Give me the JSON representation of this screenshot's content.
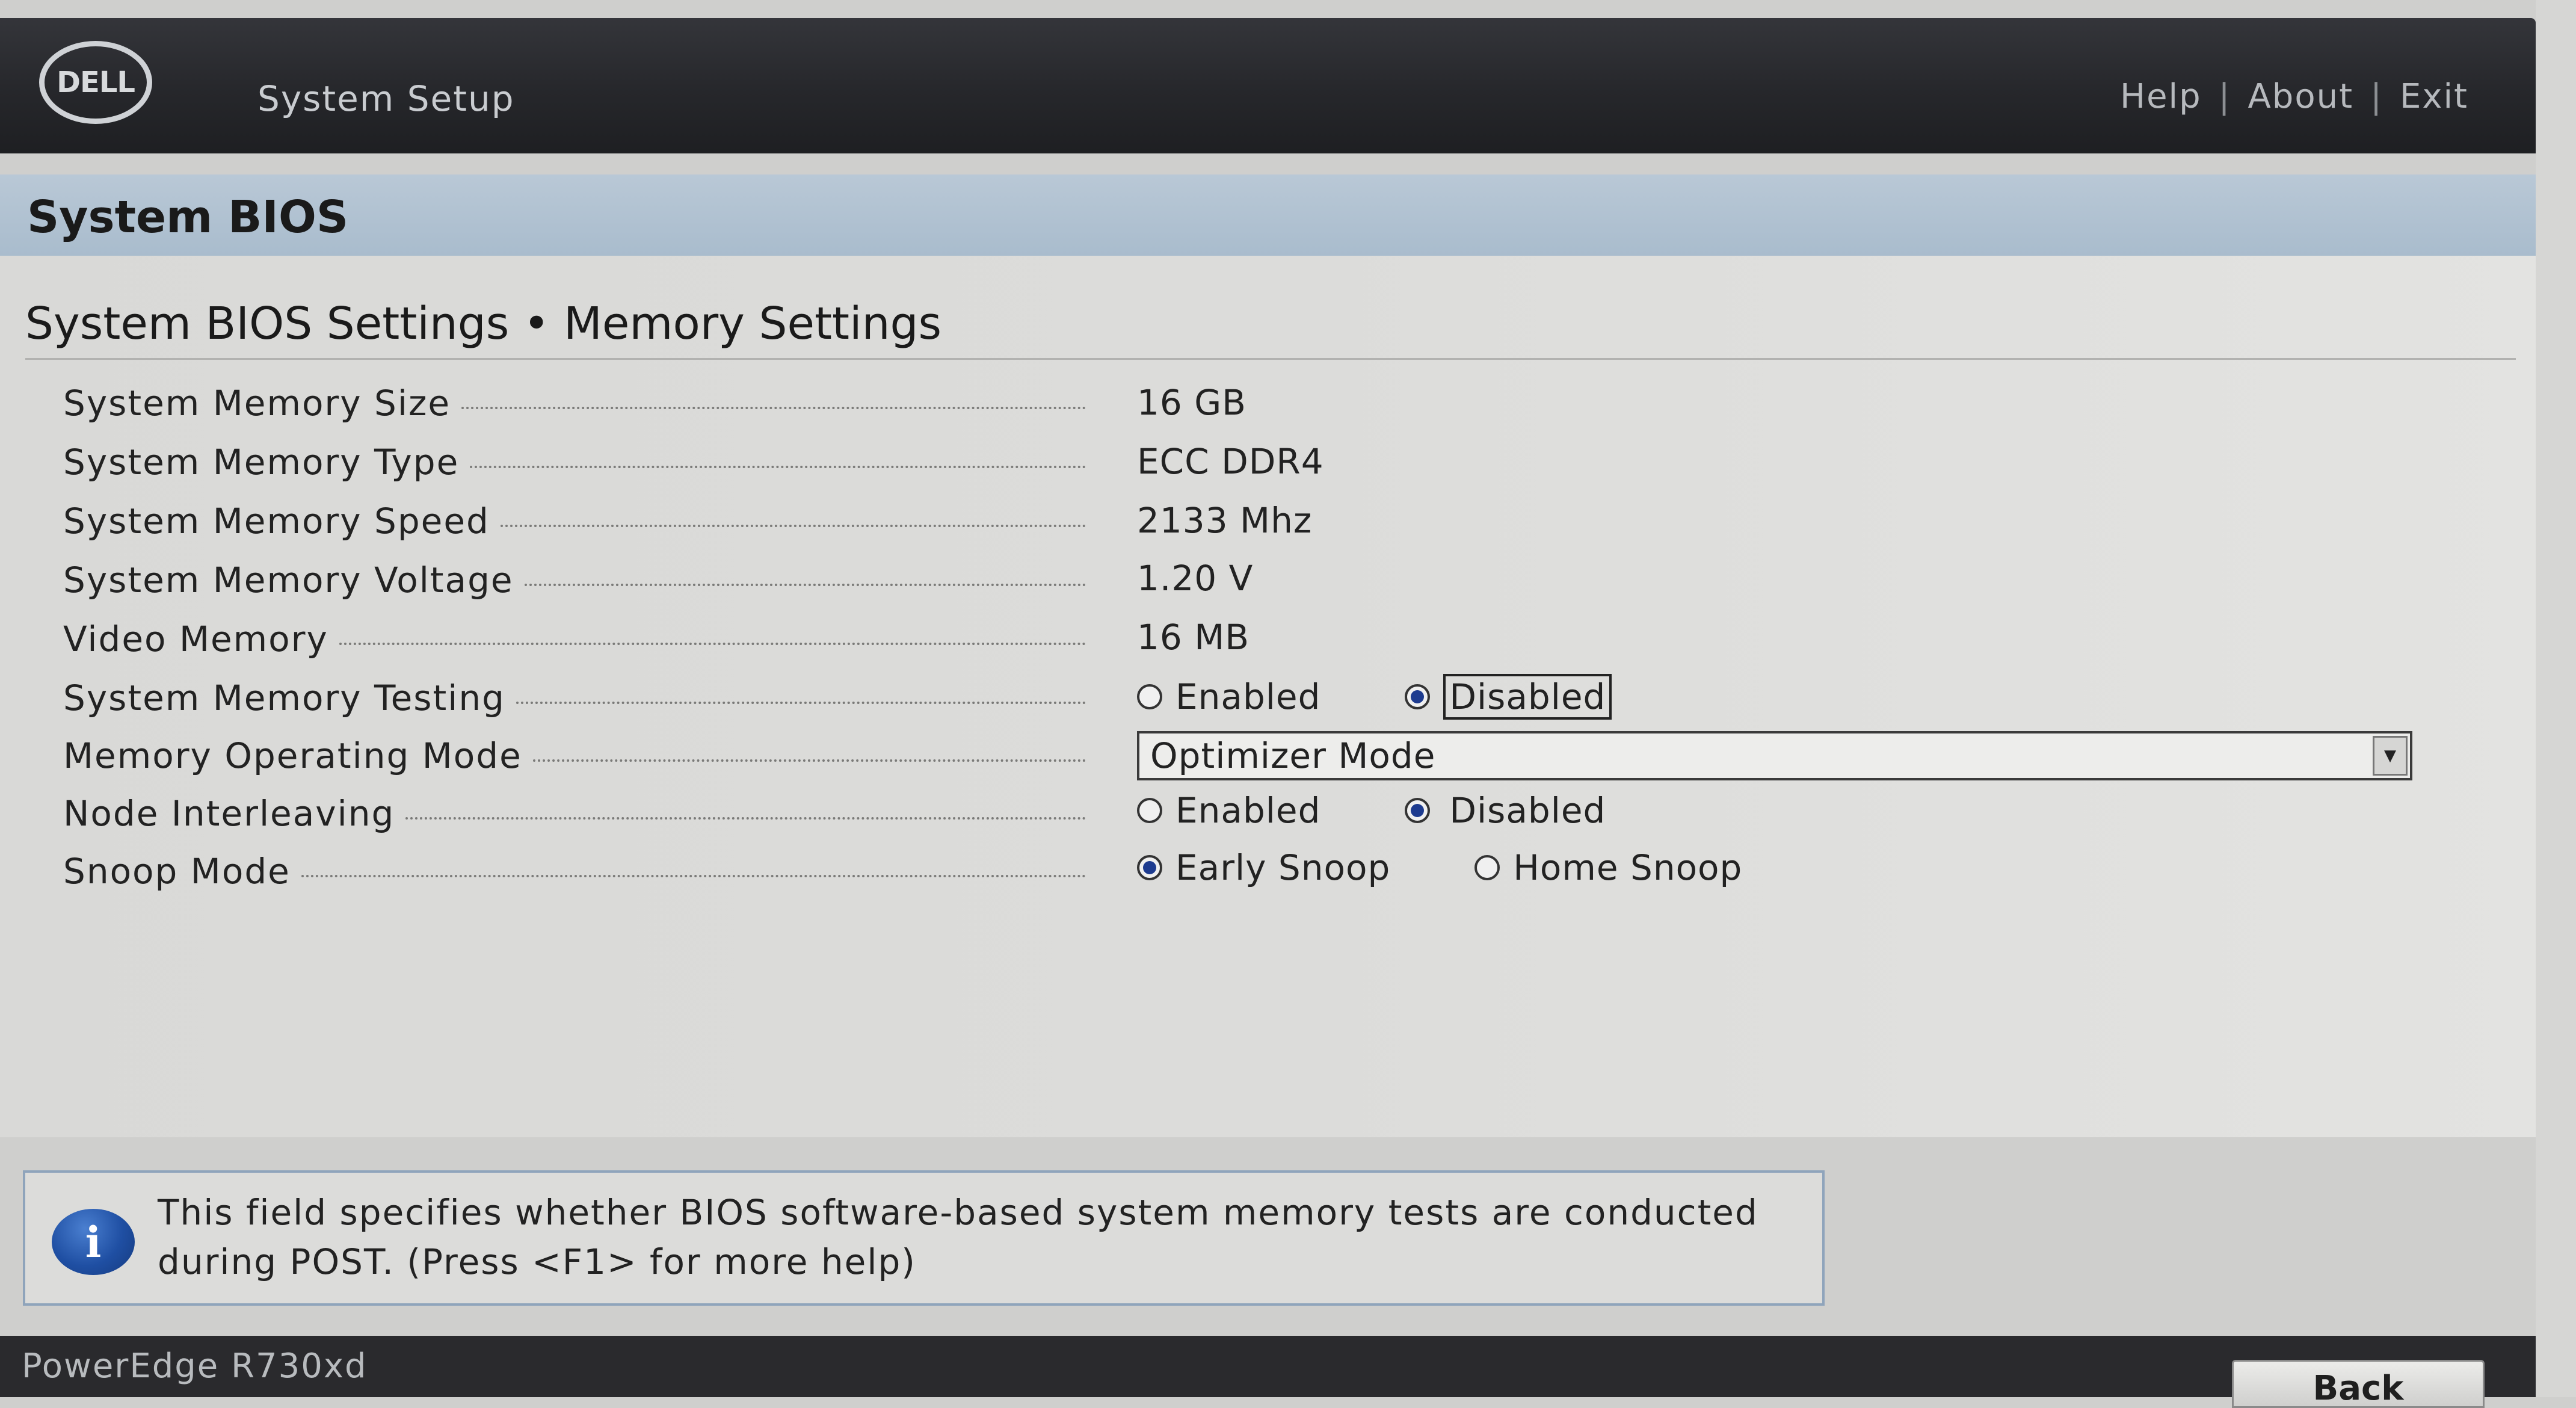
{
  "header": {
    "logo_text": "DELL",
    "app_title": "System Setup",
    "links": [
      "Help",
      "About",
      "Exit"
    ]
  },
  "section": {
    "title": "System BIOS"
  },
  "page": {
    "heading": "System BIOS Settings • Memory Settings",
    "rows": [
      {
        "label": "System Memory Size",
        "value": "16 GB"
      },
      {
        "label": "System Memory Type",
        "value": "ECC DDR4"
      },
      {
        "label": "System Memory Speed",
        "value": "2133 Mhz"
      },
      {
        "label": "System Memory Voltage",
        "value": "1.20 V"
      },
      {
        "label": "Video Memory",
        "value": "16 MB"
      },
      {
        "label": "System Memory Testing",
        "options": [
          "Enabled",
          "Disabled"
        ],
        "selected": "Disabled"
      },
      {
        "label": "Memory Operating Mode",
        "value": "Optimizer Mode"
      },
      {
        "label": "Node Interleaving",
        "options": [
          "Enabled",
          "Disabled"
        ],
        "selected": "Disabled"
      },
      {
        "label": "Snoop Mode",
        "options": [
          "Early Snoop",
          "Home Snoop"
        ],
        "selected": "Early Snoop"
      }
    ]
  },
  "help": {
    "line1": "This field specifies whether BIOS software-based system memory tests are conducted",
    "line2": "during POST. (Press <F1> for more help)"
  },
  "footer": {
    "model": "PowerEdge R730xd",
    "back_label": "Back"
  },
  "colors": {
    "header_bg": "#26272b",
    "section_bar": "#b9c8d6",
    "radio_selected": "#1d3b8f",
    "info_icon": "#1f4fa3"
  }
}
